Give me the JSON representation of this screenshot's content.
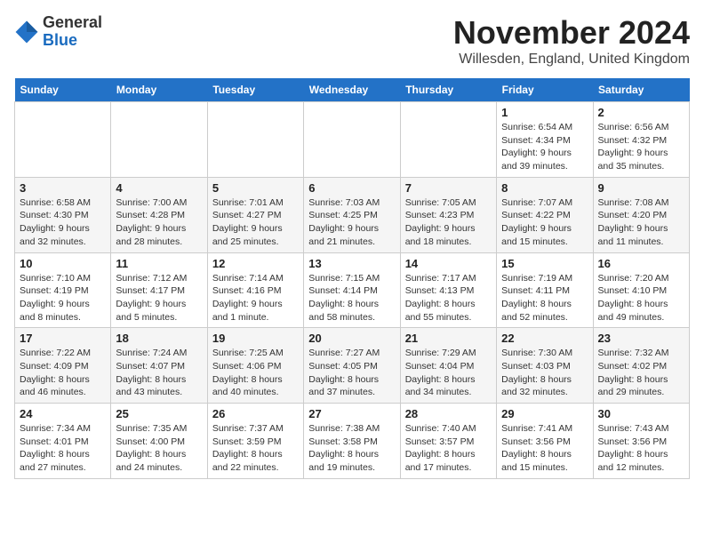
{
  "logo": {
    "general": "General",
    "blue": "Blue"
  },
  "header": {
    "month": "November 2024",
    "location": "Willesden, England, United Kingdom"
  },
  "weekdays": [
    "Sunday",
    "Monday",
    "Tuesday",
    "Wednesday",
    "Thursday",
    "Friday",
    "Saturday"
  ],
  "weeks": [
    [
      {
        "day": "",
        "info": ""
      },
      {
        "day": "",
        "info": ""
      },
      {
        "day": "",
        "info": ""
      },
      {
        "day": "",
        "info": ""
      },
      {
        "day": "",
        "info": ""
      },
      {
        "day": "1",
        "info": "Sunrise: 6:54 AM\nSunset: 4:34 PM\nDaylight: 9 hours and 39 minutes."
      },
      {
        "day": "2",
        "info": "Sunrise: 6:56 AM\nSunset: 4:32 PM\nDaylight: 9 hours and 35 minutes."
      }
    ],
    [
      {
        "day": "3",
        "info": "Sunrise: 6:58 AM\nSunset: 4:30 PM\nDaylight: 9 hours and 32 minutes."
      },
      {
        "day": "4",
        "info": "Sunrise: 7:00 AM\nSunset: 4:28 PM\nDaylight: 9 hours and 28 minutes."
      },
      {
        "day": "5",
        "info": "Sunrise: 7:01 AM\nSunset: 4:27 PM\nDaylight: 9 hours and 25 minutes."
      },
      {
        "day": "6",
        "info": "Sunrise: 7:03 AM\nSunset: 4:25 PM\nDaylight: 9 hours and 21 minutes."
      },
      {
        "day": "7",
        "info": "Sunrise: 7:05 AM\nSunset: 4:23 PM\nDaylight: 9 hours and 18 minutes."
      },
      {
        "day": "8",
        "info": "Sunrise: 7:07 AM\nSunset: 4:22 PM\nDaylight: 9 hours and 15 minutes."
      },
      {
        "day": "9",
        "info": "Sunrise: 7:08 AM\nSunset: 4:20 PM\nDaylight: 9 hours and 11 minutes."
      }
    ],
    [
      {
        "day": "10",
        "info": "Sunrise: 7:10 AM\nSunset: 4:19 PM\nDaylight: 9 hours and 8 minutes."
      },
      {
        "day": "11",
        "info": "Sunrise: 7:12 AM\nSunset: 4:17 PM\nDaylight: 9 hours and 5 minutes."
      },
      {
        "day": "12",
        "info": "Sunrise: 7:14 AM\nSunset: 4:16 PM\nDaylight: 9 hours and 1 minute."
      },
      {
        "day": "13",
        "info": "Sunrise: 7:15 AM\nSunset: 4:14 PM\nDaylight: 8 hours and 58 minutes."
      },
      {
        "day": "14",
        "info": "Sunrise: 7:17 AM\nSunset: 4:13 PM\nDaylight: 8 hours and 55 minutes."
      },
      {
        "day": "15",
        "info": "Sunrise: 7:19 AM\nSunset: 4:11 PM\nDaylight: 8 hours and 52 minutes."
      },
      {
        "day": "16",
        "info": "Sunrise: 7:20 AM\nSunset: 4:10 PM\nDaylight: 8 hours and 49 minutes."
      }
    ],
    [
      {
        "day": "17",
        "info": "Sunrise: 7:22 AM\nSunset: 4:09 PM\nDaylight: 8 hours and 46 minutes."
      },
      {
        "day": "18",
        "info": "Sunrise: 7:24 AM\nSunset: 4:07 PM\nDaylight: 8 hours and 43 minutes."
      },
      {
        "day": "19",
        "info": "Sunrise: 7:25 AM\nSunset: 4:06 PM\nDaylight: 8 hours and 40 minutes."
      },
      {
        "day": "20",
        "info": "Sunrise: 7:27 AM\nSunset: 4:05 PM\nDaylight: 8 hours and 37 minutes."
      },
      {
        "day": "21",
        "info": "Sunrise: 7:29 AM\nSunset: 4:04 PM\nDaylight: 8 hours and 34 minutes."
      },
      {
        "day": "22",
        "info": "Sunrise: 7:30 AM\nSunset: 4:03 PM\nDaylight: 8 hours and 32 minutes."
      },
      {
        "day": "23",
        "info": "Sunrise: 7:32 AM\nSunset: 4:02 PM\nDaylight: 8 hours and 29 minutes."
      }
    ],
    [
      {
        "day": "24",
        "info": "Sunrise: 7:34 AM\nSunset: 4:01 PM\nDaylight: 8 hours and 27 minutes."
      },
      {
        "day": "25",
        "info": "Sunrise: 7:35 AM\nSunset: 4:00 PM\nDaylight: 8 hours and 24 minutes."
      },
      {
        "day": "26",
        "info": "Sunrise: 7:37 AM\nSunset: 3:59 PM\nDaylight: 8 hours and 22 minutes."
      },
      {
        "day": "27",
        "info": "Sunrise: 7:38 AM\nSunset: 3:58 PM\nDaylight: 8 hours and 19 minutes."
      },
      {
        "day": "28",
        "info": "Sunrise: 7:40 AM\nSunset: 3:57 PM\nDaylight: 8 hours and 17 minutes."
      },
      {
        "day": "29",
        "info": "Sunrise: 7:41 AM\nSunset: 3:56 PM\nDaylight: 8 hours and 15 minutes."
      },
      {
        "day": "30",
        "info": "Sunrise: 7:43 AM\nSunset: 3:56 PM\nDaylight: 8 hours and 12 minutes."
      }
    ]
  ]
}
